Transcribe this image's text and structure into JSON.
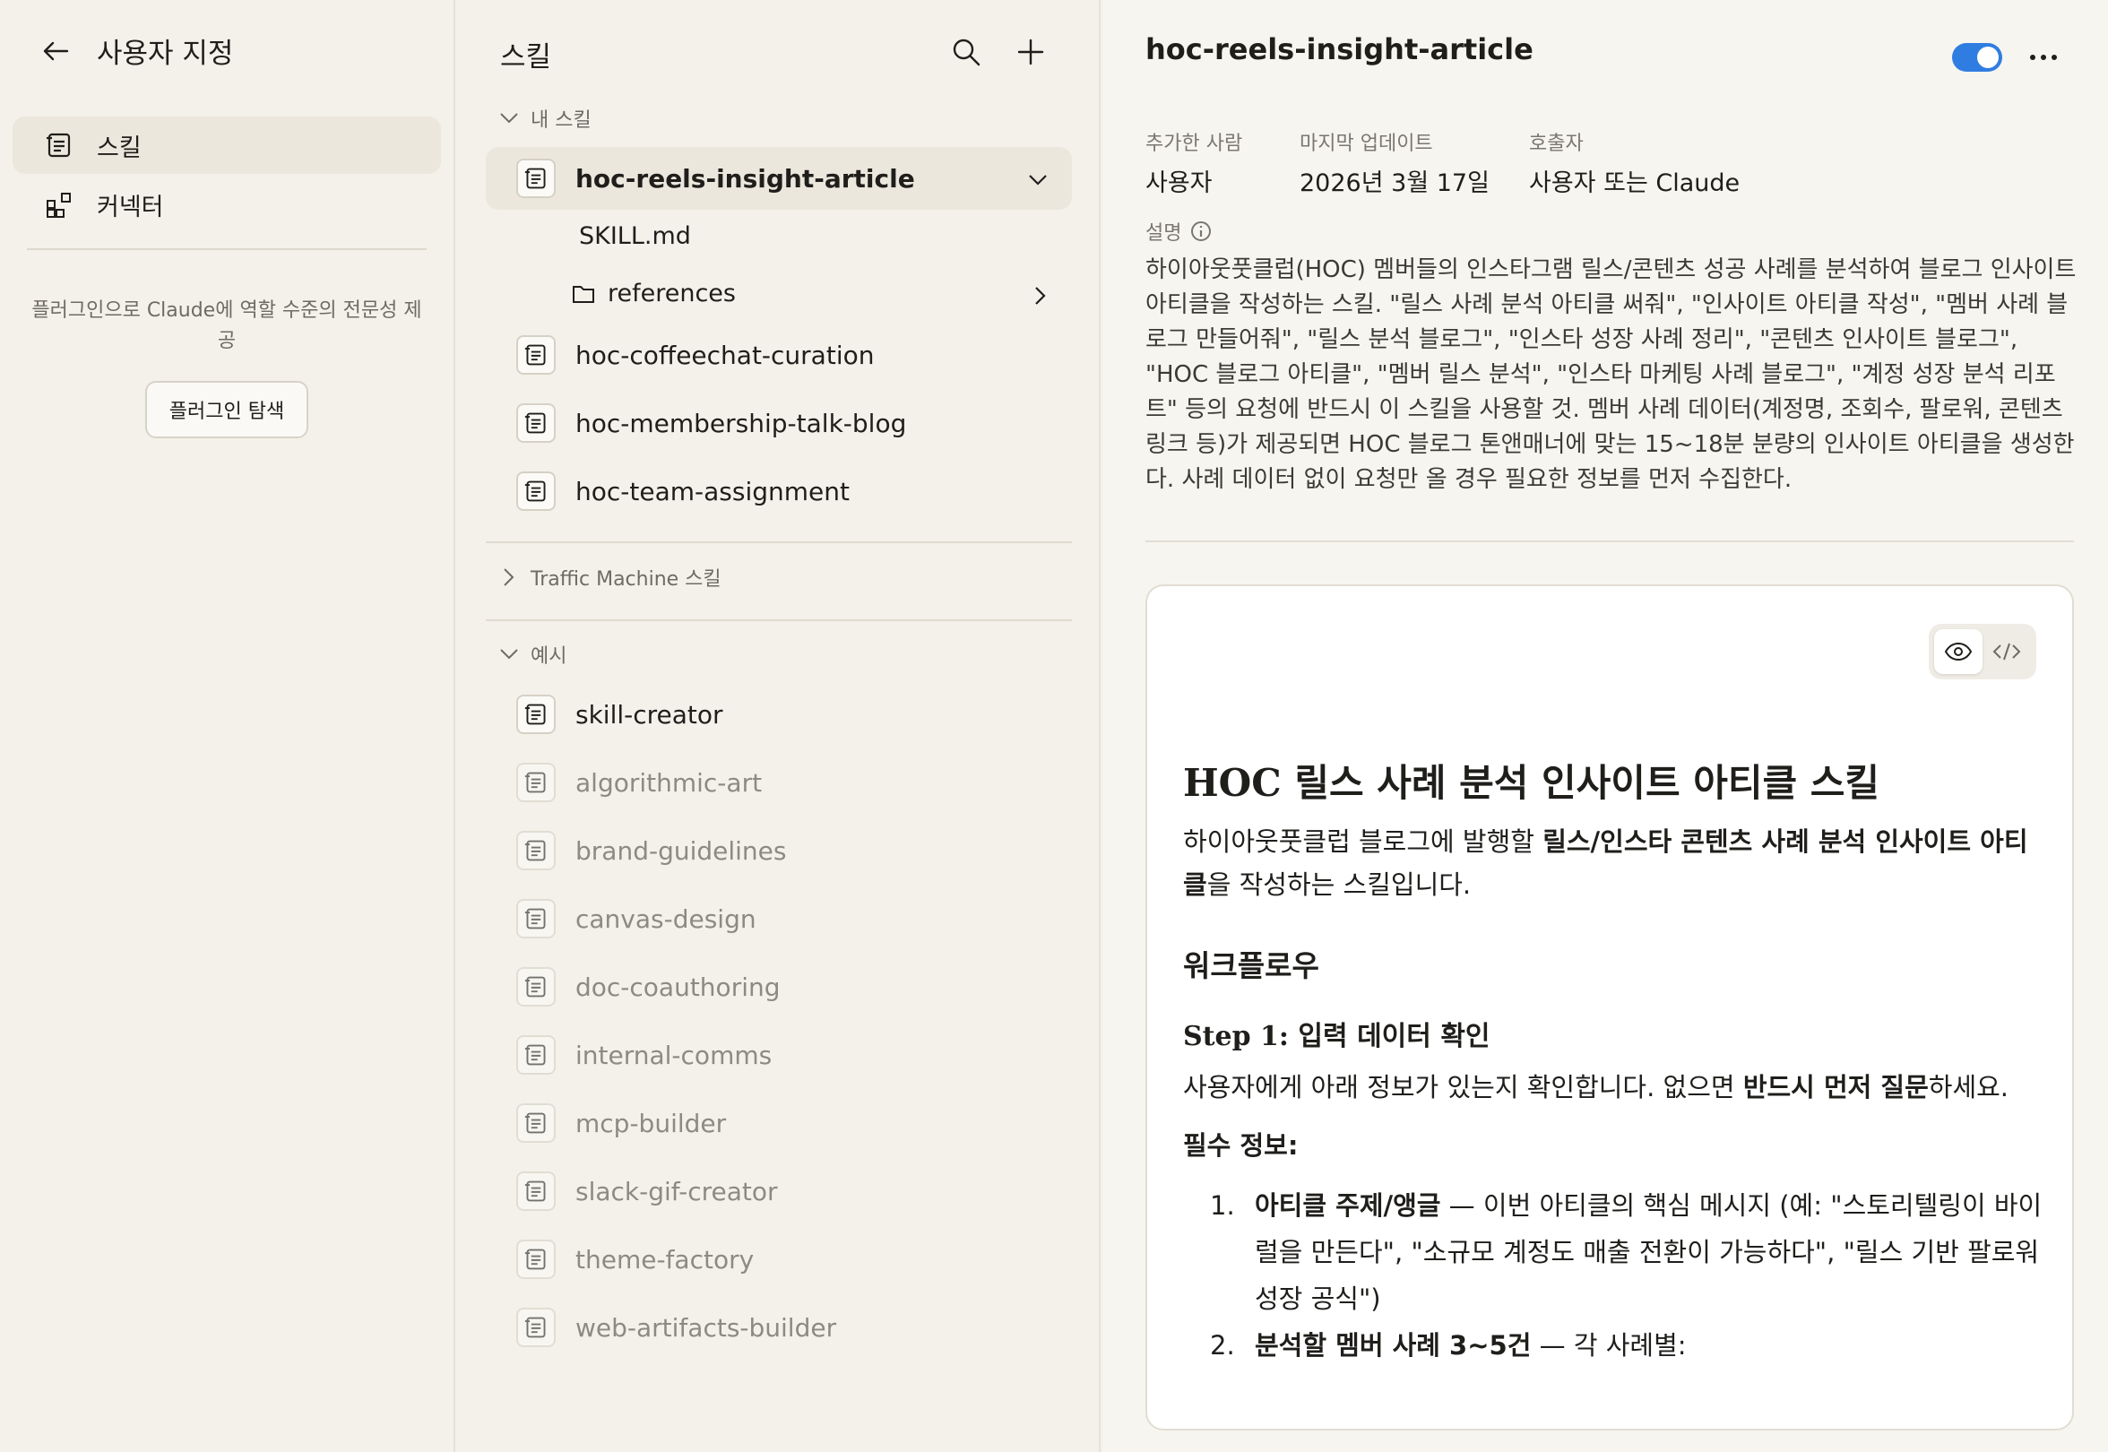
{
  "left": {
    "title": "사용자 지정",
    "nav": [
      {
        "label": "스킬",
        "icon": "skill-icon",
        "active": true
      },
      {
        "label": "커넥터",
        "icon": "connector-icon",
        "active": false
      }
    ],
    "plugin_desc": "플러그인으로 Claude에 역할 수준의 전문성 제공",
    "plugin_button": "플러그인 탐색"
  },
  "mid": {
    "title": "스킬",
    "my_section": "내 스킬",
    "my_skills": [
      {
        "name": "hoc-reels-insight-article",
        "active": true
      },
      {
        "name": "hoc-coffeechat-curation"
      },
      {
        "name": "hoc-membership-talk-blog"
      },
      {
        "name": "hoc-team-assignment"
      }
    ],
    "files": [
      {
        "name": "SKILL.md",
        "type": "file"
      },
      {
        "name": "references",
        "type": "folder"
      }
    ],
    "traffic_section": "Traffic Machine 스킬",
    "example_section": "예시",
    "example_skills": [
      {
        "name": "skill-creator",
        "enabled": true
      },
      {
        "name": "algorithmic-art",
        "enabled": false
      },
      {
        "name": "brand-guidelines",
        "enabled": false
      },
      {
        "name": "canvas-design",
        "enabled": false
      },
      {
        "name": "doc-coauthoring",
        "enabled": false
      },
      {
        "name": "internal-comms",
        "enabled": false
      },
      {
        "name": "mcp-builder",
        "enabled": false
      },
      {
        "name": "slack-gif-creator",
        "enabled": false
      },
      {
        "name": "theme-factory",
        "enabled": false
      },
      {
        "name": "web-artifacts-builder",
        "enabled": false
      }
    ]
  },
  "right": {
    "title": "hoc-reels-insight-article",
    "toggle_on": true,
    "accent": "#2f7de1",
    "meta": {
      "added_by_label": "추가한 사람",
      "added_by": "사용자",
      "updated_label": "마지막 업데이트",
      "updated": "2026년 3월 17일",
      "caller_label": "호출자",
      "caller": "사용자 또는 Claude"
    },
    "description_label": "설명",
    "description": "하이아웃풋클럽(HOC) 멤버들의 인스타그램 릴스/콘텐츠 성공 사례를 분석하여 블로그 인사이트 아티클을 작성하는 스킬. \"릴스 사례 분석 아티클 써줘\", \"인사이트 아티클 작성\", \"멤버 사례 블로그 만들어줘\", \"릴스 분석 블로그\", \"인스타 성장 사례 정리\", \"콘텐츠 인사이트 블로그\", \"HOC 블로그 아티클\", \"멤버 릴스 분석\", \"인스타 마케팅 사례 블로그\", \"계정 성장 분석 리포트\" 등의 요청에 반드시 이 스킬을 사용할 것. 멤버 사례 데이터(계정명, 조회수, 팔로워, 콘텐츠 링크 등)가 제공되면 HOC 블로그 톤앤매너에 맞는 15~18분 분량의 인사이트 아티클을 생성한다. 사례 데이터 없이 요청만 올 경우 필요한 정보를 먼저 수집한다.",
    "doc": {
      "h1": "HOC 릴스 사례 분석 인사이트 아티클 스킬",
      "intro_a": "하이아웃풋클럽 블로그에 발행할 ",
      "intro_b": "릴스/인스타 콘텐츠 사례 분석 인사이트 아티클",
      "intro_c": "을 작성하는 스킬입니다.",
      "h2": "워크플로우",
      "step_a": "Step 1:",
      "step_b": " 입력 데이터 확인",
      "p2_a": "사용자에게 아래 정보가 있는지 확인합니다. 없으면 ",
      "p2_b": "반드시 먼저 질문",
      "p2_c": "하세요.",
      "req": "필수 정보:",
      "items": [
        {
          "num": "1.",
          "bold": "아티클 주제/앵글",
          "rest": " — 이번 아티클의 핵심 메시지 (예: \"스토리텔링이 바이럴을 만든다\", \"소규모 계정도 매출 전환이 가능하다\", \"릴스 기반 팔로워 성장 공식\")"
        },
        {
          "num": "2.",
          "bold": "분석할 멤버 사례 3~5건",
          "rest": " — 각 사례별:"
        }
      ]
    }
  }
}
